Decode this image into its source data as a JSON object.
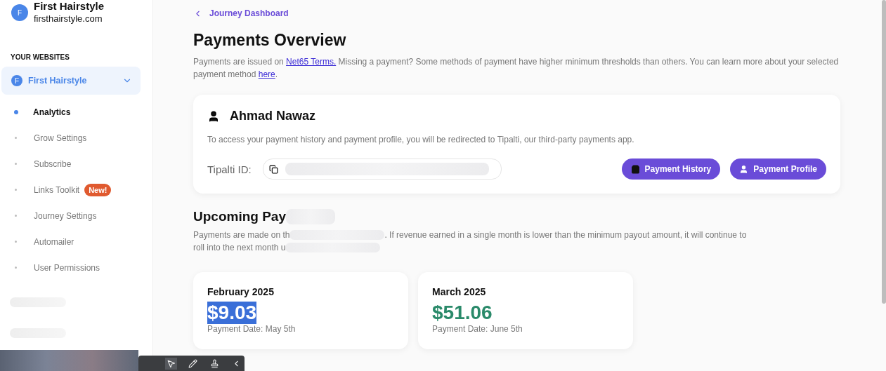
{
  "sidebar": {
    "site": {
      "avatar": "F",
      "name": "First Hairstyle",
      "domain": "firsthairstyle.com"
    },
    "section_label": "YOUR WEBSITES",
    "website": {
      "avatar": "F",
      "name": "First Hairstyle",
      "expanded": true
    },
    "items": [
      {
        "label": "Analytics",
        "selected": true
      },
      {
        "label": "Grow Settings",
        "selected": false
      },
      {
        "label": "Subscribe",
        "selected": false
      },
      {
        "label": "Links Toolkit",
        "selected": false,
        "badge": "New!"
      },
      {
        "label": "Journey Settings",
        "selected": false
      },
      {
        "label": "Automailer",
        "selected": false
      },
      {
        "label": "User Permissions",
        "selected": false
      }
    ],
    "redacted_items": [
      {
        "kind": "redacted"
      },
      {
        "kind": "redacted"
      }
    ]
  },
  "main": {
    "back_link": "Journey Dashboard",
    "title": "Payments Overview",
    "intro": [
      {
        "kind": "text",
        "text": "Payments are issued on "
      },
      {
        "kind": "link",
        "text": "Net65 Terms."
      },
      {
        "kind": "text",
        "text": " Missing a payment? Some methods of payment have higher minimum thresholds than others. You can learn more about your selected payment method "
      },
      {
        "kind": "link",
        "text": "here"
      },
      {
        "kind": "text",
        "text": "."
      }
    ],
    "account": {
      "name": "Ahmad Nawaz",
      "description": "To access your payment history and payment profile, you will be redirected to Tipalti, our third-party payments app.",
      "id_label": "Tipalti ID:",
      "buttons": [
        {
          "kind": "history",
          "label": "Payment History"
        },
        {
          "kind": "profile",
          "label": "Payment Profile"
        }
      ]
    },
    "upcoming": {
      "heading": [
        {
          "kind": "text",
          "text": "Upcoming Pay"
        },
        {
          "kind": "redacted"
        }
      ],
      "description": [
        [
          {
            "kind": "text",
            "text": "Payments are made on th"
          },
          {
            "kind": "redacted"
          },
          {
            "kind": "text",
            "text": ". If revenue earned in a single month is lower than the minimum payout amount, it will continue to"
          }
        ],
        [
          {
            "kind": "text",
            "text": "roll into the next month u"
          },
          {
            "kind": "redacted"
          }
        ]
      ],
      "months": [
        {
          "month": "February 2025",
          "amount": "$9.03",
          "date": "Payment Date: May 5th",
          "highlighted": true
        },
        {
          "month": "March 2025",
          "amount": "$51.06",
          "date": "Payment Date: June 5th",
          "highlighted": false
        }
      ]
    }
  },
  "toolbar": {
    "tools": [
      {
        "kind": "pointer",
        "selected": true
      },
      {
        "kind": "pen",
        "selected": false
      },
      {
        "kind": "stamp",
        "selected": false
      },
      {
        "kind": "collapse",
        "selected": false
      }
    ]
  }
}
